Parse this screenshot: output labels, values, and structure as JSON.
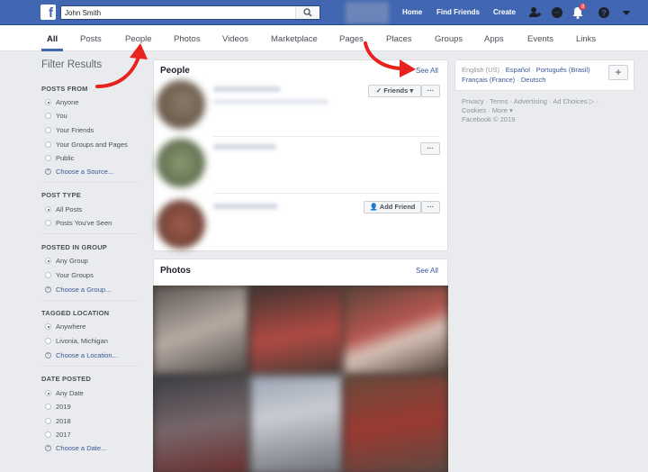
{
  "topbar": {
    "search_value": "John Smith",
    "links": [
      "Home",
      "Find Friends",
      "Create"
    ],
    "notification_count": "8",
    "icons": [
      "facebook-logo-icon",
      "search-icon",
      "friends-icon",
      "messenger-icon",
      "bell-icon",
      "help-icon",
      "caret-down-icon"
    ],
    "brand_color": "#4267b2"
  },
  "tabs": [
    "All",
    "Posts",
    "People",
    "Photos",
    "Videos",
    "Marketplace",
    "Pages",
    "Places",
    "Groups",
    "Apps",
    "Events",
    "Links"
  ],
  "filters": {
    "title": "Filter Results",
    "sections": [
      {
        "heading": "POSTS FROM",
        "options": [
          "Anyone",
          "You",
          "Your Friends",
          "Your Groups and Pages",
          "Public"
        ],
        "action": "Choose a Source..."
      },
      {
        "heading": "POST TYPE",
        "options": [
          "All Posts",
          "Posts You've Seen"
        ]
      },
      {
        "heading": "POSTED IN GROUP",
        "options": [
          "Any Group",
          "Your Groups"
        ],
        "action": "Choose a Group..."
      },
      {
        "heading": "TAGGED LOCATION",
        "options": [
          "Anywhere",
          "Livonia, Michigan"
        ],
        "action": "Choose a Location..."
      },
      {
        "heading": "DATE POSTED",
        "options": [
          "Any Date",
          "2019",
          "2018",
          "2017"
        ],
        "action": "Choose a Date..."
      }
    ]
  },
  "people": {
    "title": "People",
    "see_all": "See All",
    "friends_button": "Friends",
    "add_friend_button": "Add Friend",
    "more_button": "···"
  },
  "photos": {
    "title": "Photos",
    "see_all": "See All"
  },
  "languages": {
    "current": "English (US)",
    "links": [
      "Español",
      "Português (Brasil)",
      "Français (France)",
      "Deutsch"
    ],
    "plus": "+"
  },
  "footer": {
    "line1": [
      "Privacy",
      "Terms",
      "Advertising",
      "Ad Choices"
    ],
    "line2": [
      "Cookies",
      "More"
    ],
    "copyright": "Facebook © 2019"
  }
}
